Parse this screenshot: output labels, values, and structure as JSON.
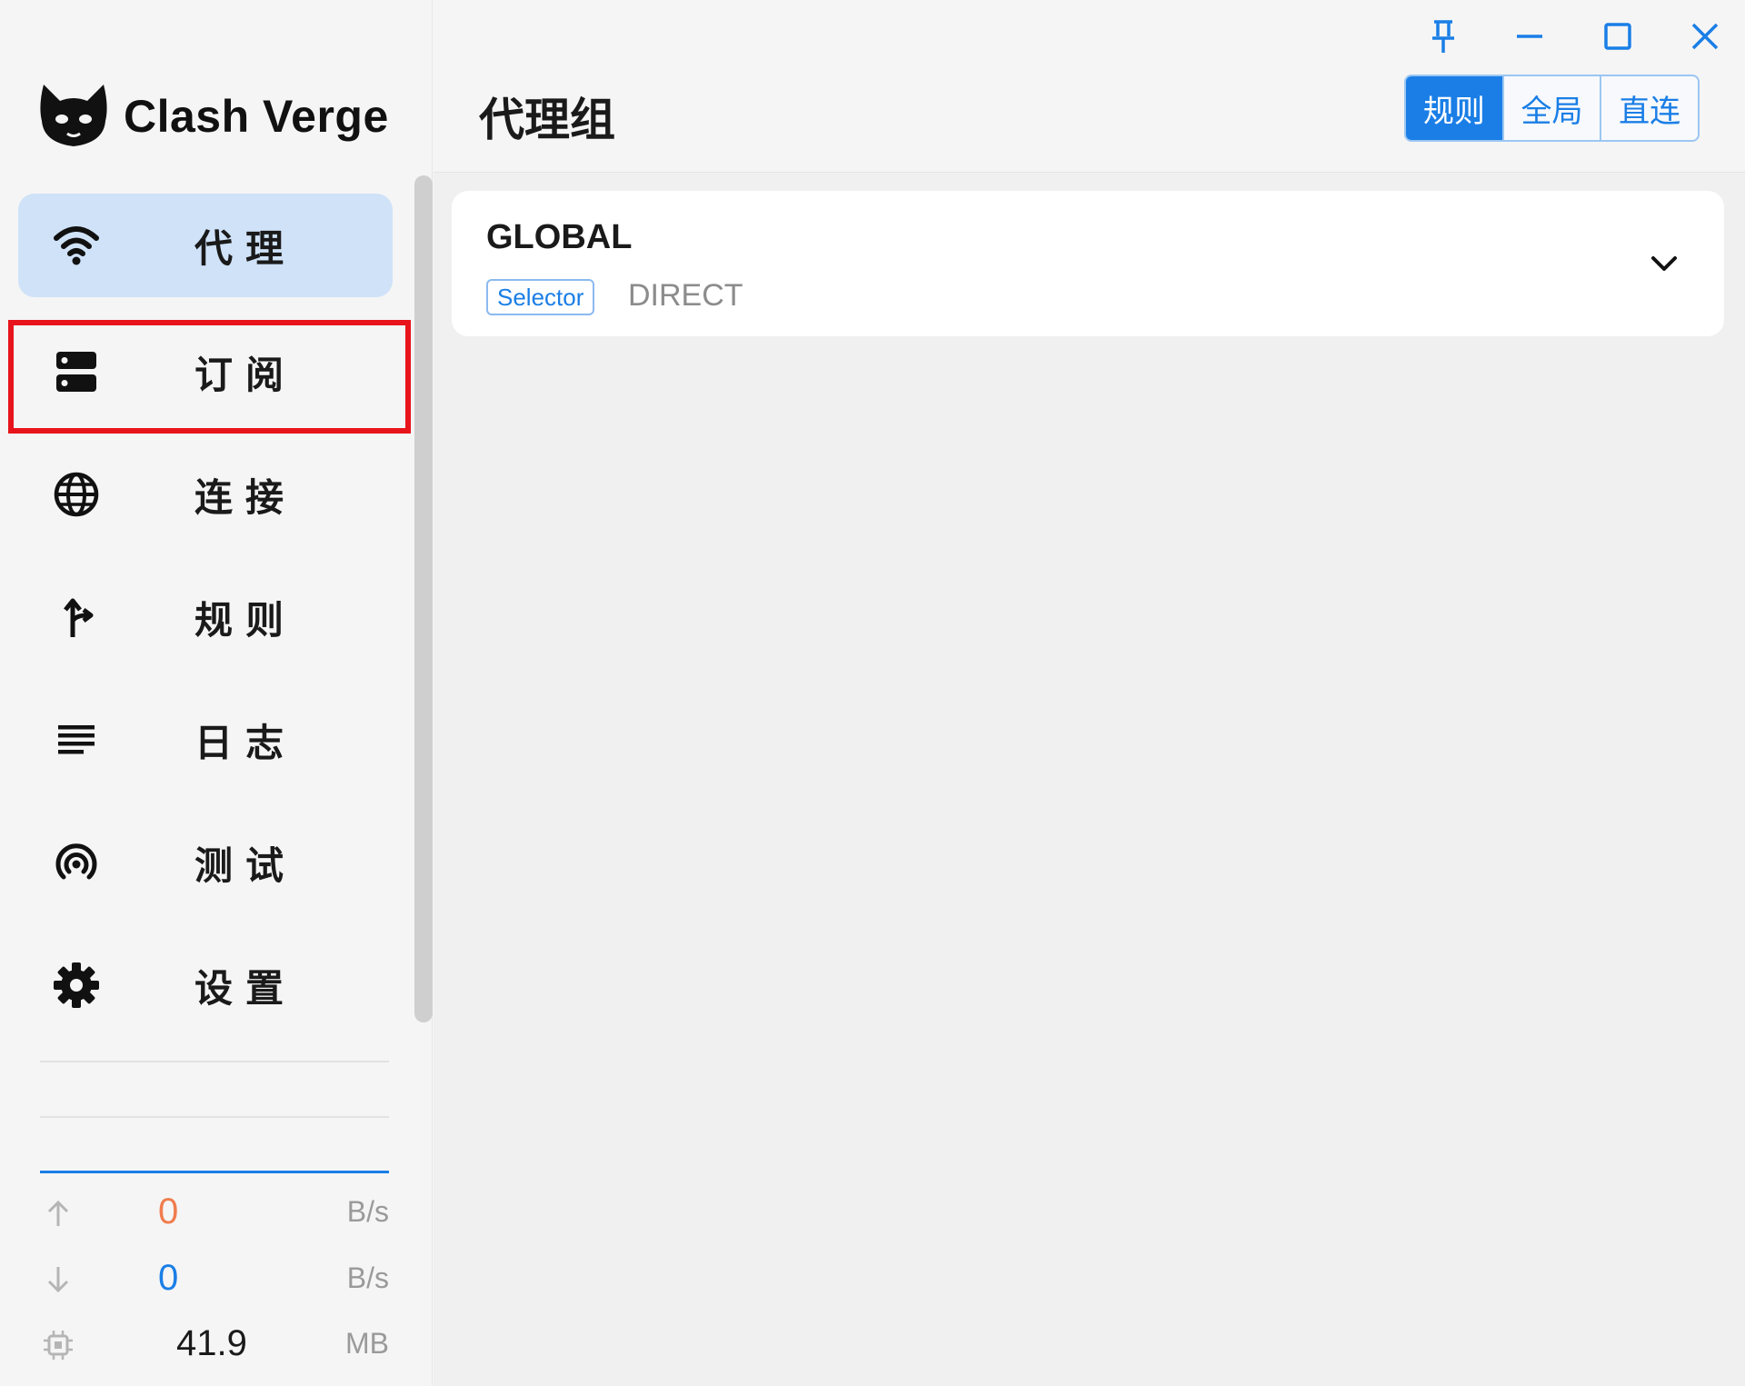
{
  "app": {
    "name": "Clash Verge"
  },
  "sidebar": {
    "items": [
      {
        "label": "代理",
        "icon": "wifi-icon",
        "active": true
      },
      {
        "label": "订阅",
        "icon": "server-icon",
        "active": false
      },
      {
        "label": "连接",
        "icon": "globe-icon",
        "active": false
      },
      {
        "label": "规则",
        "icon": "fork-arrow-icon",
        "active": false
      },
      {
        "label": "日志",
        "icon": "lines-icon",
        "active": false
      },
      {
        "label": "测试",
        "icon": "radar-icon",
        "active": false
      },
      {
        "label": "设置",
        "icon": "gear-icon",
        "active": false
      }
    ],
    "highlighted_item": "订阅"
  },
  "traffic": {
    "upload": {
      "value": "0",
      "unit": "B/s",
      "color": "#f07c4e"
    },
    "download": {
      "value": "0",
      "unit": "B/s",
      "color": "#1a7ee6"
    },
    "memory": {
      "value": "41.9",
      "unit": "MB",
      "color": "#1a1a1a"
    }
  },
  "header": {
    "title": "代理组",
    "modes": [
      {
        "label": "规则",
        "active": true
      },
      {
        "label": "全局",
        "active": false
      },
      {
        "label": "直连",
        "active": false
      }
    ]
  },
  "groups": [
    {
      "name": "GLOBAL",
      "type": "Selector",
      "now": "DIRECT"
    }
  ],
  "colors": {
    "accent": "#1a7ee6",
    "active_nav_bg": "#cfe2f8",
    "highlight_box": "#e8141c"
  }
}
